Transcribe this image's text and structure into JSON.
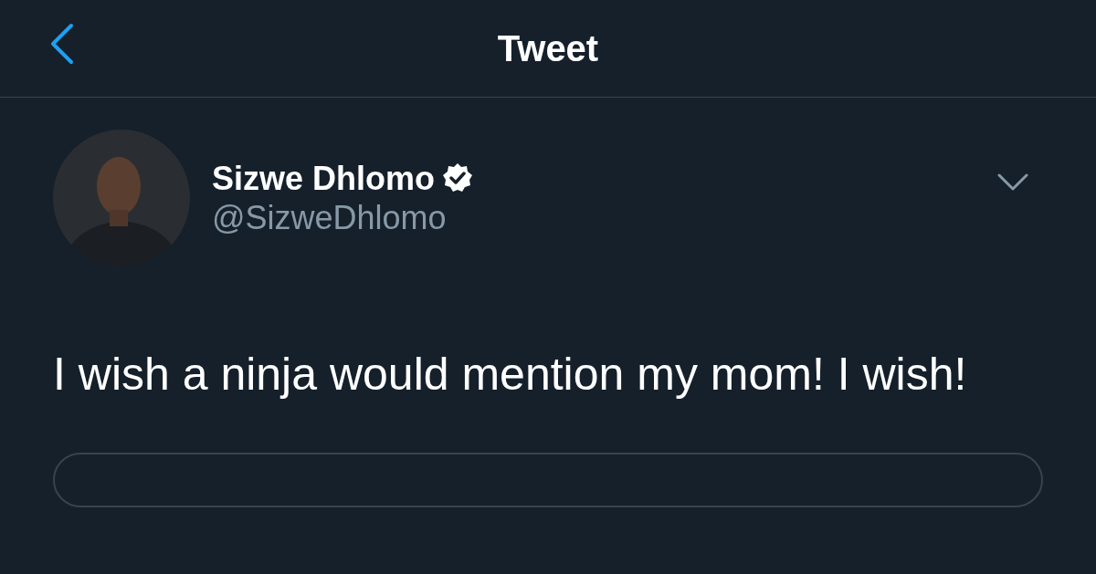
{
  "header": {
    "title": "Tweet"
  },
  "tweet": {
    "author": {
      "name": "Sizwe Dhlomo",
      "verified": true,
      "handle": "@SizweDhlomo"
    },
    "text": "I wish a ninja would mention my mom! I wish!"
  }
}
